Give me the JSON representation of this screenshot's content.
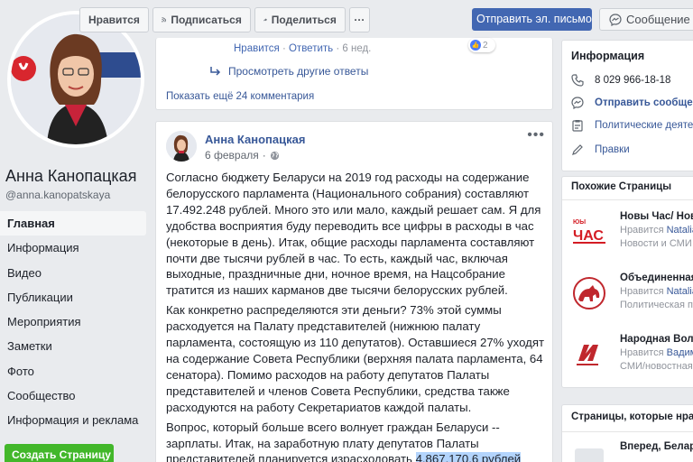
{
  "toolbar": {
    "like_label": "Нравится",
    "subscribe_label": "Подписаться",
    "share_label": "Поделиться",
    "more_label": "···",
    "send_email_label": "Отправить эл. письмо",
    "message_label": "Сообщение"
  },
  "profile": {
    "name": "Анна Канопацкая",
    "handle": "@anna.kanopatskaya"
  },
  "nav": {
    "items": [
      {
        "label": "Главная",
        "active": true
      },
      {
        "label": "Информация"
      },
      {
        "label": "Видео"
      },
      {
        "label": "Публикации"
      },
      {
        "label": "Мероприятия"
      },
      {
        "label": "Заметки"
      },
      {
        "label": "Фото"
      },
      {
        "label": "Сообщество"
      },
      {
        "label": "Информация и реклама"
      }
    ],
    "create_page_label": "Создать Страницу"
  },
  "comments": {
    "like_link": "Нравится",
    "reply_link": "Ответить",
    "age": "6 нед.",
    "reaction_count": "2",
    "more_replies": "Просмотреть другие ответы",
    "more_comments": "Показать ещё 24 комментария"
  },
  "post": {
    "author": "Анна Канопацкая",
    "date": "6 февраля",
    "paragraphs": [
      "Согласно бюджету Беларуси на 2019 год расходы на содержание белорусского парламента (Национального собрания) составляют 17.492.248 рублей. Много это или мало, каждый решает сам. Я для удобства восприятия буду переводить все цифры в расходы в час (некоторые в день). Итак, общие расходы парламента составляют почти две тысячи рублей в час. То есть, каждый час, включая выходные, праздничные дни, ночное время, на Нацсобрание тратится из наших карманов две тысячи белорусских рублей.",
      "Как конкретно распределяются эти деньги? 73% этой суммы расходуется на Палату представителей (нижнюю палату парламента, состоящую из 110 депутатов). Оставшиеся 27% уходят на содержание Совета Республики (верхняя палата парламента, 64 сенатора). Помимо расходов на работу депутатов Палаты представителей и членов Совета Республики, средства также расходуются на работу Секретариатов каждой палаты."
    ],
    "last_paragraph_start": "Вопрос, который больше всего волнует граждан Беларуси -- зарплаты. Итак, на заработную плату депутатов Палаты представителей планируется израсходовать ",
    "last_paragraph_highlight": "4.867.170,6 рублей"
  },
  "info": {
    "title": "Информация",
    "phone": "8 029 966-18-18",
    "send_message": "Отправить сообщение",
    "category": "Политические деятели",
    "edits": "Правки"
  },
  "similar": {
    "title": "Похожие Страницы",
    "items": [
      {
        "name": "Новы Час/ Новое Время",
        "liked_prefix": "Нравится ",
        "liked_by": "Natalia",
        "category": "Новости и СМИ"
      },
      {
        "name": "Объединенная Гражданская Партия",
        "liked_prefix": "Нравится ",
        "liked_by": "Natalia",
        "category": "Политическая партия"
      },
      {
        "name": "Народная Воля",
        "liked_prefix": "Нравится ",
        "liked_by": "Вадим",
        "category": "СМИ/новостная компания"
      }
    ],
    "logo_text": "ЧАС",
    "logo_small": "ЮЫ"
  },
  "liked_pages": {
    "title": "Страницы, которые нравятся этой Странице",
    "first_item": "Вперед, Беларусь"
  },
  "colors": {
    "brand": "#4267b2",
    "link": "#385898",
    "green": "#42b72a"
  }
}
